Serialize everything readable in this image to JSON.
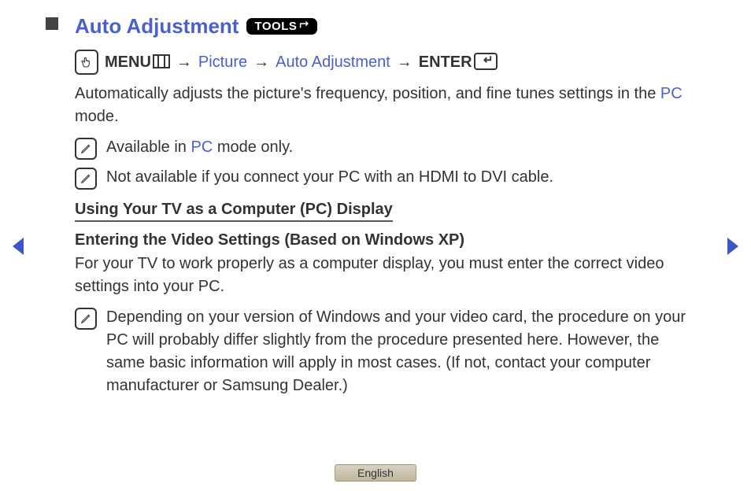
{
  "title": "Auto Adjustment",
  "tools_label": "TOOLS",
  "path": {
    "menu": "MENU",
    "picture": "Picture",
    "auto_adjustment": "Auto Adjustment",
    "enter": "ENTER",
    "sep": "→"
  },
  "desc_pre": "Automatically adjusts the picture's frequency, position, and fine tunes settings in the ",
  "desc_pc": "PC",
  "desc_post": " mode.",
  "note1_pre": "Available in ",
  "note1_pc": "PC",
  "note1_post": " mode only.",
  "note2": "Not available if you connect your PC with an HDMI to DVI cable.",
  "section_head": "Using Your TV as a Computer (PC) Display",
  "sub_head": "Entering the Video Settings (Based on Windows XP)",
  "sub_body": "For your TV to work properly as a computer display, you must enter the correct video settings into your PC.",
  "note3": "Depending on your version of Windows and your video card, the procedure on your PC will probably differ slightly from the procedure presented here. However, the same basic information will apply in most cases. (If not, contact your computer manufacturer or Samsung Dealer.)",
  "language": "English"
}
